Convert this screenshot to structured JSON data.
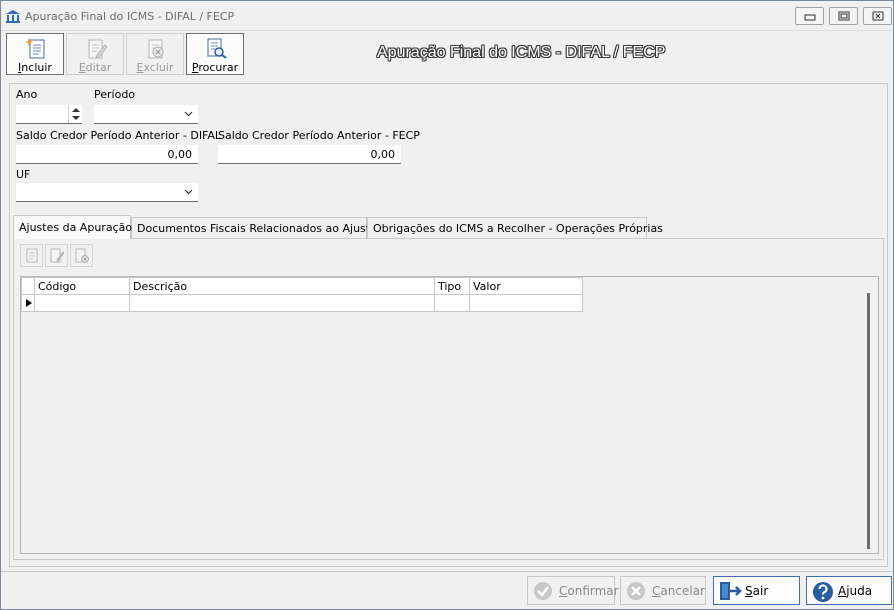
{
  "window": {
    "title": "Apuração Final do ICMS - DIFAL / FECP",
    "controls": [
      "minimize",
      "maximize",
      "close"
    ]
  },
  "toolbar": {
    "incluir": "Incluir",
    "editar": "Editar",
    "excluir": "Excluir",
    "procurar": "Procurar"
  },
  "form_title": "Apuração Final do ICMS - DIFAL / FECP",
  "fields": {
    "ano_label": "Ano",
    "ano_value": "",
    "periodo_label": "Período",
    "periodo_value": "",
    "saldo_difal_label": "Saldo Credor Período Anterior - DIFAL",
    "saldo_difal_value": "0,00",
    "saldo_fecp_label": "Saldo Credor Período Anterior - FECP",
    "saldo_fecp_value": "0,00",
    "uf_label": "UF",
    "uf_value": ""
  },
  "tabs": [
    {
      "label": "Ajustes da Apuração",
      "active": true
    },
    {
      "label": "Documentos Fiscais Relacionados ao Ajuste",
      "active": false
    },
    {
      "label": "Obrigações do ICMS a Recolher - Operações Próprias",
      "active": false
    }
  ],
  "grid": {
    "columns": [
      "Código",
      "Descrição",
      "Tipo",
      "Valor"
    ],
    "rows": [
      [
        "",
        "",
        "",
        ""
      ]
    ]
  },
  "footer": {
    "confirmar": "Confirmar",
    "cancelar": "Cancelar",
    "sair": "Sair",
    "ajuda": "Ajuda"
  },
  "colors": {
    "accent_border": "#3d6fb0",
    "help_icon": "#2a5d9e",
    "exit_icon": "#2a5d9e"
  }
}
